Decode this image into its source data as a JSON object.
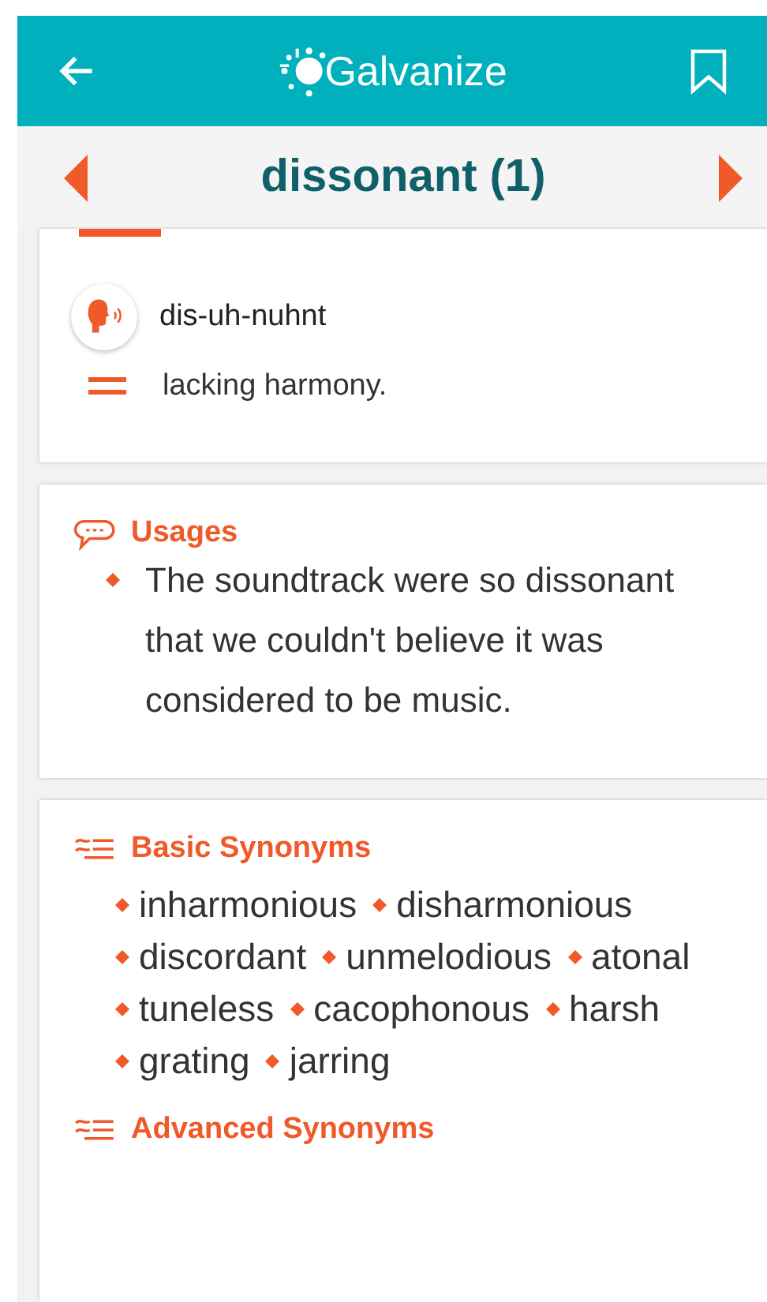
{
  "app_bar": {
    "logo": "Galvanize"
  },
  "word_bar": {
    "title": "dissonant (1)"
  },
  "entry": {
    "pronunciation": "dis-uh-nuhnt",
    "definition": "lacking harmony."
  },
  "cards": [
    {
      "sections": [
        {
          "kind": "usages",
          "title": "Usages",
          "items": [
            "The soundtrack were so dissonant that we couldn't believe it was considered to be music."
          ]
        }
      ]
    },
    {
      "sections": [
        {
          "kind": "synonyms",
          "title": "Basic Synonyms",
          "items": [
            "inharmonious",
            "disharmonious",
            "discordant",
            "unmelodious",
            "atonal",
            "tuneless",
            "cacophonous",
            "harsh",
            "grating",
            "jarring"
          ]
        },
        {
          "kind": "synonyms",
          "title": "Advanced Synonyms"
        }
      ]
    }
  ]
}
